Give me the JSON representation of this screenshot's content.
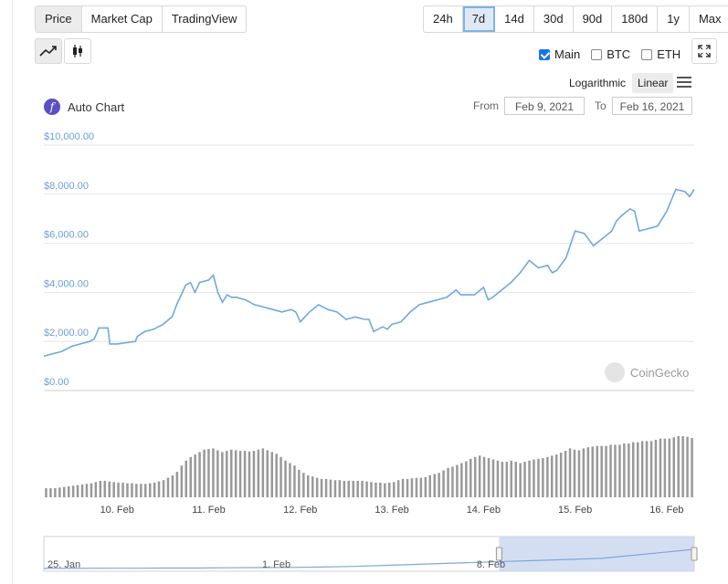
{
  "tabs": [
    {
      "label": "Price",
      "active": true
    },
    {
      "label": "Market Cap",
      "active": false
    },
    {
      "label": "TradingView",
      "active": false
    }
  ],
  "ranges": [
    {
      "label": "24h",
      "active": false
    },
    {
      "label": "7d",
      "active": true
    },
    {
      "label": "14d",
      "active": false
    },
    {
      "label": "30d",
      "active": false
    },
    {
      "label": "90d",
      "active": false
    },
    {
      "label": "180d",
      "active": false
    },
    {
      "label": "1y",
      "active": false
    },
    {
      "label": "Max",
      "active": false
    }
  ],
  "chart_style_icons": [
    "line-chart-icon",
    "candlestick-icon"
  ],
  "expand_icon": "expand-icon",
  "series_toggles": [
    {
      "label": "Main",
      "checked": true
    },
    {
      "label": "BTC",
      "checked": false
    },
    {
      "label": "ETH",
      "checked": false
    }
  ],
  "scale": {
    "log_label": "Logarithmic",
    "linear_label": "Linear",
    "selected": "Linear"
  },
  "menu_icon": "hamburger-menu-icon",
  "autochart": {
    "icon_letter": "f",
    "label": "Auto Chart"
  },
  "date_range": {
    "from_label": "From",
    "from_value": "Feb 9, 2021",
    "to_label": "To",
    "to_value": "Feb 16, 2021"
  },
  "watermark": "CoinGecko",
  "colors": {
    "line": "#6fa9e0",
    "axis_label": "#6b9fd6",
    "volume": "#999999",
    "navigator_fill": "#c8d6f0",
    "navigator_line": "#7fa7d9"
  },
  "chart_data": {
    "type": "line",
    "ylabels": [
      "$0.00",
      "$2,000.00",
      "$4,000.00",
      "$6,000.00",
      "$8,000.00",
      "$10,000.00"
    ],
    "ylim": [
      0,
      10000
    ],
    "xlim": [
      0,
      7.1
    ],
    "xticks": [
      {
        "x": 0.8,
        "label": "10. Feb"
      },
      {
        "x": 1.8,
        "label": "11. Feb"
      },
      {
        "x": 2.8,
        "label": "12. Feb"
      },
      {
        "x": 3.8,
        "label": "13. Feb"
      },
      {
        "x": 4.8,
        "label": "14. Feb"
      },
      {
        "x": 5.8,
        "label": "15. Feb"
      },
      {
        "x": 6.8,
        "label": "16. Feb"
      }
    ],
    "price": {
      "x": [
        0,
        0.1,
        0.2,
        0.25,
        0.3,
        0.4,
        0.5,
        0.55,
        0.6,
        0.7,
        0.72,
        0.8,
        1.0,
        1.02,
        1.1,
        1.2,
        1.3,
        1.4,
        1.45,
        1.55,
        1.6,
        1.65,
        1.7,
        1.8,
        1.85,
        1.9,
        1.95,
        2.0,
        2.05,
        2.1,
        2.2,
        2.3,
        2.4,
        2.5,
        2.6,
        2.7,
        2.75,
        2.8,
        2.9,
        3.0,
        3.1,
        3.2,
        3.3,
        3.4,
        3.5,
        3.55,
        3.6,
        3.7,
        3.75,
        3.8,
        3.9,
        4.0,
        4.1,
        4.2,
        4.3,
        4.4,
        4.5,
        4.55,
        4.6,
        4.7,
        4.8,
        4.85,
        4.9,
        5.0,
        5.1,
        5.2,
        5.3,
        5.4,
        5.5,
        5.55,
        5.6,
        5.7,
        5.8,
        5.9,
        6.0,
        6.1,
        6.2,
        6.25,
        6.3,
        6.4,
        6.45,
        6.5,
        6.6,
        6.7,
        6.8,
        6.9,
        7.0,
        7.05,
        7.1
      ],
      "y": [
        1400,
        1500,
        1600,
        1700,
        1800,
        1900,
        2000,
        2100,
        2550,
        2550,
        1900,
        1900,
        2000,
        2200,
        2400,
        2500,
        2700,
        3000,
        3500,
        4300,
        4400,
        4000,
        4400,
        4500,
        4700,
        4000,
        3600,
        3900,
        3800,
        3800,
        3700,
        3500,
        3400,
        3300,
        3200,
        3300,
        3200,
        2800,
        3200,
        3500,
        3300,
        3200,
        2900,
        3000,
        2900,
        2900,
        2400,
        2600,
        2500,
        2700,
        2800,
        3200,
        3500,
        3600,
        3700,
        3800,
        4100,
        3900,
        3900,
        3900,
        4200,
        3700,
        3800,
        4100,
        4400,
        4800,
        5300,
        5000,
        5100,
        4800,
        4900,
        5400,
        6500,
        6400,
        5900,
        6200,
        6500,
        6900,
        7100,
        7400,
        7300,
        6500,
        6600,
        6700,
        7300,
        8200,
        8100,
        7900,
        8200
      ]
    },
    "volume": {
      "label": "Volume",
      "values": [
        0.15,
        0.15,
        0.15,
        0.16,
        0.17,
        0.18,
        0.19,
        0.2,
        0.21,
        0.22,
        0.23,
        0.25,
        0.27,
        0.27,
        0.26,
        0.25,
        0.24,
        0.24,
        0.23,
        0.23,
        0.22,
        0.22,
        0.22,
        0.23,
        0.24,
        0.26,
        0.28,
        0.32,
        0.36,
        0.42,
        0.52,
        0.6,
        0.66,
        0.7,
        0.74,
        0.78,
        0.79,
        0.8,
        0.77,
        0.74,
        0.76,
        0.78,
        0.77,
        0.76,
        0.76,
        0.75,
        0.76,
        0.78,
        0.8,
        0.77,
        0.74,
        0.71,
        0.66,
        0.6,
        0.56,
        0.52,
        0.45,
        0.4,
        0.36,
        0.34,
        0.32,
        0.3,
        0.3,
        0.29,
        0.28,
        0.28,
        0.27,
        0.27,
        0.27,
        0.27,
        0.27,
        0.26,
        0.25,
        0.24,
        0.24,
        0.23,
        0.24,
        0.25,
        0.28,
        0.3,
        0.3,
        0.31,
        0.32,
        0.32,
        0.33,
        0.36,
        0.38,
        0.4,
        0.44,
        0.48,
        0.5,
        0.53,
        0.56,
        0.59,
        0.63,
        0.66,
        0.68,
        0.66,
        0.64,
        0.62,
        0.6,
        0.58,
        0.58,
        0.6,
        0.58,
        0.56,
        0.58,
        0.6,
        0.62,
        0.63,
        0.64,
        0.66,
        0.68,
        0.7,
        0.73,
        0.76,
        0.8,
        0.78,
        0.77,
        0.8,
        0.82,
        0.83,
        0.84,
        0.84,
        0.84,
        0.86,
        0.86,
        0.86,
        0.88,
        0.88,
        0.9,
        0.9,
        0.92,
        0.92,
        0.92,
        0.94,
        0.96,
        0.96,
        0.96,
        0.98,
        1.0,
        1.0,
        0.99,
        0.97
      ]
    },
    "navigator": {
      "labels": [
        "25. Jan",
        "1. Feb",
        "8. Feb"
      ],
      "trend": [
        0.05,
        0.05,
        0.06,
        0.06,
        0.07,
        0.07,
        0.08,
        0.09,
        0.1,
        0.12,
        0.15,
        0.2,
        0.25,
        0.3,
        0.35,
        0.4,
        0.45,
        0.5,
        0.55,
        0.7,
        0.85,
        1.0
      ],
      "window": [
        0.7,
        1.0
      ]
    }
  }
}
